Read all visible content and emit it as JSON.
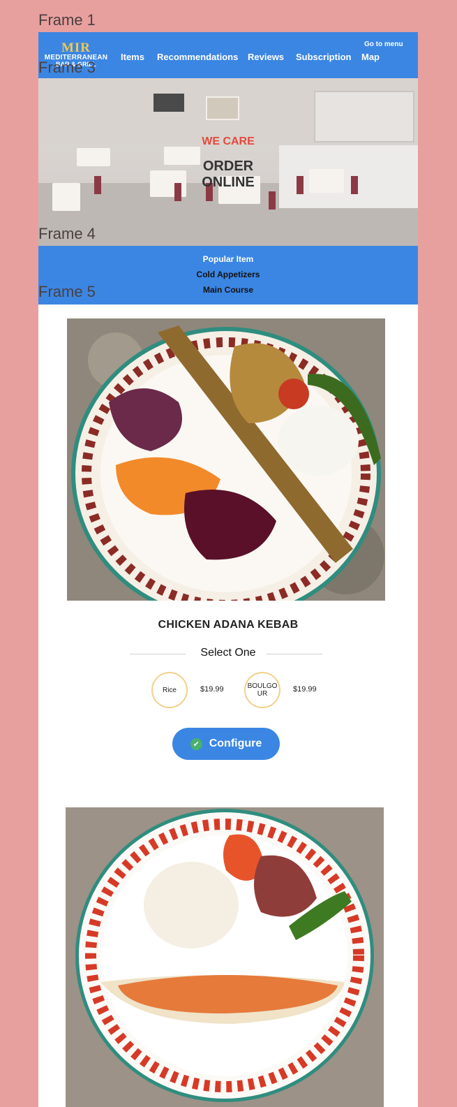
{
  "frames": {
    "frame1": "Frame 1",
    "frame3": "Frame 3",
    "frame4": "Frame 4",
    "frame5": "Frame 5"
  },
  "header": {
    "logo_main": "MIR",
    "logo_sub": "MEDITERRANEAN",
    "logo_sub2": "BAR & GRILL",
    "nav": [
      "Items",
      "Recommendations",
      "Reviews",
      "Subscription",
      "Map"
    ],
    "go_to_menu": "Go to menu"
  },
  "hero": {
    "tagline": "WE CARE",
    "headline_line1": "ORDER",
    "headline_line2": "ONLINE"
  },
  "categories": [
    {
      "label": "Popular Item",
      "active": true
    },
    {
      "label": "Cold Appetizers",
      "active": false
    },
    {
      "label": "Main Course",
      "active": false
    }
  ],
  "item": {
    "name": "CHICKEN ADANA KEBAB",
    "select_label": "Select One",
    "options": [
      {
        "label": "Rice",
        "price": "$19.99"
      },
      {
        "label": "BOULGOUR",
        "price": "$19.99"
      }
    ],
    "configure_label": "Configure"
  },
  "colors": {
    "page_bg": "#e8a09f",
    "accent": "#3b86e3",
    "option_ring": "#f3d08a",
    "we_care": "#e24a3b"
  }
}
